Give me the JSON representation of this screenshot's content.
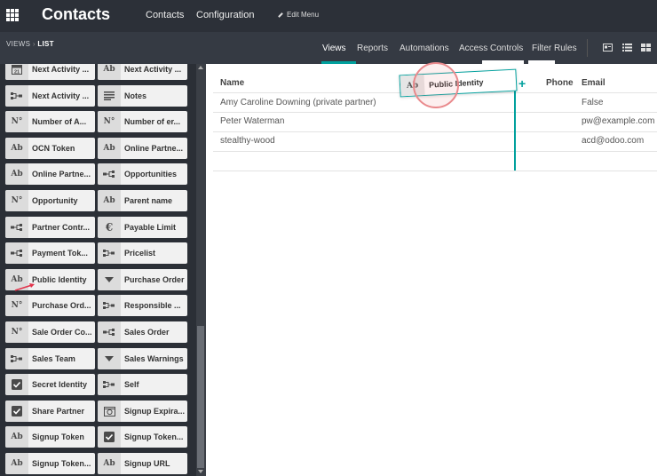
{
  "navbar": {
    "title": "Contacts",
    "menu": [
      "Contacts",
      "Configuration"
    ],
    "edit_menu": "Edit Menu"
  },
  "subbar": {
    "breadcrumb_root": "VIEWS",
    "breadcrumb_current": "LIST",
    "tabs": [
      "Views",
      "Reports",
      "Automations",
      "Access Controls",
      "Filter Rules"
    ]
  },
  "sidebar": {
    "fields": [
      {
        "label": "Next Activity ...",
        "icon": "calendar-icon"
      },
      {
        "label": "Next Activity ...",
        "icon": "text-icon"
      },
      {
        "label": "Next Activity ...",
        "icon": "many2one-icon"
      },
      {
        "label": "Notes",
        "icon": "html-icon"
      },
      {
        "label": "Number of A...",
        "icon": "number-icon"
      },
      {
        "label": "Number of er...",
        "icon": "number-icon"
      },
      {
        "label": "OCN Token",
        "icon": "text-icon"
      },
      {
        "label": "Online Partne...",
        "icon": "text-icon"
      },
      {
        "label": "Online Partne...",
        "icon": "text-icon"
      },
      {
        "label": "Opportunities",
        "icon": "one2many-icon"
      },
      {
        "label": "Opportunity",
        "icon": "number-icon"
      },
      {
        "label": "Parent name",
        "icon": "text-icon"
      },
      {
        "label": "Partner Contr...",
        "icon": "one2many-icon"
      },
      {
        "label": "Payable Limit",
        "icon": "monetary-icon"
      },
      {
        "label": "Payment Tok...",
        "icon": "one2many-icon"
      },
      {
        "label": "Pricelist",
        "icon": "many2one-icon"
      },
      {
        "label": "Public Identity",
        "icon": "text-icon"
      },
      {
        "label": "Purchase Order",
        "icon": "selection-icon"
      },
      {
        "label": "Purchase Ord...",
        "icon": "number-icon"
      },
      {
        "label": "Responsible ...",
        "icon": "many2one-icon"
      },
      {
        "label": "Sale Order Co...",
        "icon": "number-icon"
      },
      {
        "label": "Sales Order",
        "icon": "one2many-icon"
      },
      {
        "label": "Sales Team",
        "icon": "many2one-icon"
      },
      {
        "label": "Sales Warnings",
        "icon": "selection-icon"
      },
      {
        "label": "Secret Identity",
        "icon": "checkbox-icon"
      },
      {
        "label": "Self",
        "icon": "many2one-icon"
      },
      {
        "label": "Share Partner",
        "icon": "checkbox-icon"
      },
      {
        "label": "Signup Expira...",
        "icon": "datetime-icon"
      },
      {
        "label": "Signup Token",
        "icon": "text-icon"
      },
      {
        "label": "Signup Token...",
        "icon": "checkbox-icon"
      },
      {
        "label": "Signup Token...",
        "icon": "text-icon"
      },
      {
        "label": "Signup URL",
        "icon": "text-icon"
      }
    ]
  },
  "table": {
    "headers": {
      "name": "Name",
      "phone": "Phone",
      "email": "Email"
    },
    "rows": [
      {
        "name": "Amy Caroline Downing (private partner)",
        "email": "False"
      },
      {
        "name": "Peter Waterman",
        "email": "pw@example.com"
      },
      {
        "name": "stealthy-wood",
        "email": "acd@odoo.com"
      }
    ]
  },
  "drag": {
    "label": "Public Identity",
    "icon_text": "Ab"
  },
  "icons": {
    "text": "Ab",
    "number": "N°",
    "monetary": "€"
  },
  "colors": {
    "accent": "#00a09d",
    "navbar": "#2c3038",
    "sidebar": "#2b2f36"
  }
}
